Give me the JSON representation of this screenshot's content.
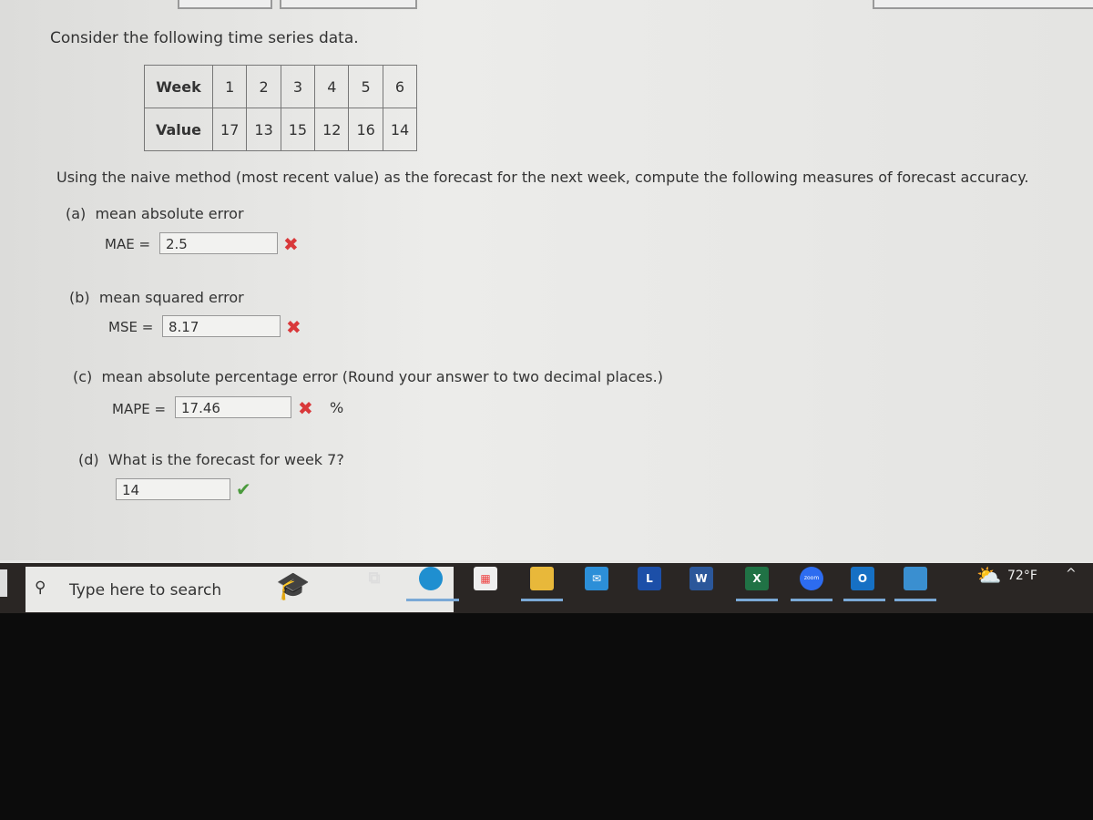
{
  "question": {
    "intro": "Consider the following time series data.",
    "table": {
      "row_labels": [
        "Week",
        "Value"
      ],
      "weeks": [
        "1",
        "2",
        "3",
        "4",
        "5",
        "6"
      ],
      "values": [
        "17",
        "13",
        "15",
        "12",
        "16",
        "14"
      ]
    },
    "instructions": "Using the naive method (most recent value) as the forecast for the next week, compute the following measures of forecast accuracy.",
    "a": {
      "label": "(a)",
      "text": "mean absolute error",
      "field_label": "MAE =",
      "value": "2.5",
      "status": "✖"
    },
    "b": {
      "label": "(b)",
      "text": "mean squared error",
      "field_label": "MSE =",
      "value": "8.17",
      "status": "✖"
    },
    "c": {
      "label": "(c)",
      "text": "mean absolute percentage error (Round your answer to two decimal places.)",
      "field_label": "MAPE =",
      "value": "17.46",
      "status": "✖",
      "unit": "%"
    },
    "d": {
      "label": "(d)",
      "text": "What is the forecast for week 7?",
      "value": "14",
      "status": "✔"
    }
  },
  "taskbar": {
    "search_placeholder": "Type here to search",
    "weather": "72°F",
    "icons": [
      "task-view",
      "edge",
      "store",
      "file-explorer",
      "mail",
      "L",
      "word",
      "excel",
      "zoom",
      "outlook-new",
      "photos"
    ],
    "labels": {
      "L": "L",
      "word": "W",
      "excel": "X",
      "zoom": "zoom",
      "outlook": "O"
    }
  },
  "colors": {
    "wrong": "#d9383a",
    "correct": "#4a9a3c",
    "taskbar": "#2a2624"
  }
}
